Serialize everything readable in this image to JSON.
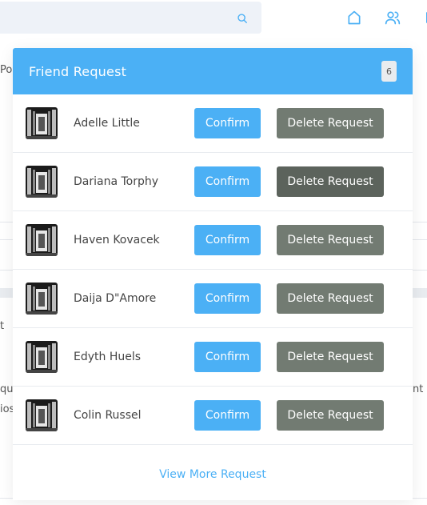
{
  "search": {
    "placeholder": "",
    "value": ""
  },
  "icons": {
    "search": "search-icon",
    "home": "home-icon",
    "users": "users-icon"
  },
  "background": {
    "left_snippets": [
      "Po",
      "t",
      "qu",
      "ios"
    ],
    "right_snippets": [
      "nt"
    ]
  },
  "friend_requests": {
    "title": "Friend Request",
    "count": "6",
    "confirm_label": "Confirm",
    "delete_label": "Delete Request",
    "items": [
      {
        "name": "Adelle Little"
      },
      {
        "name": "Dariana Torphy"
      },
      {
        "name": "Haven Kovacek"
      },
      {
        "name": "Daija D\"Amore"
      },
      {
        "name": "Edyth Huels"
      },
      {
        "name": "Colin Russel"
      }
    ],
    "view_more_label": "View More Request"
  },
  "colors": {
    "accent": "#4bb0f5",
    "delete_button": "#727b72",
    "delete_button_hover": "#5c635c",
    "search_bg": "#eef2f8"
  }
}
